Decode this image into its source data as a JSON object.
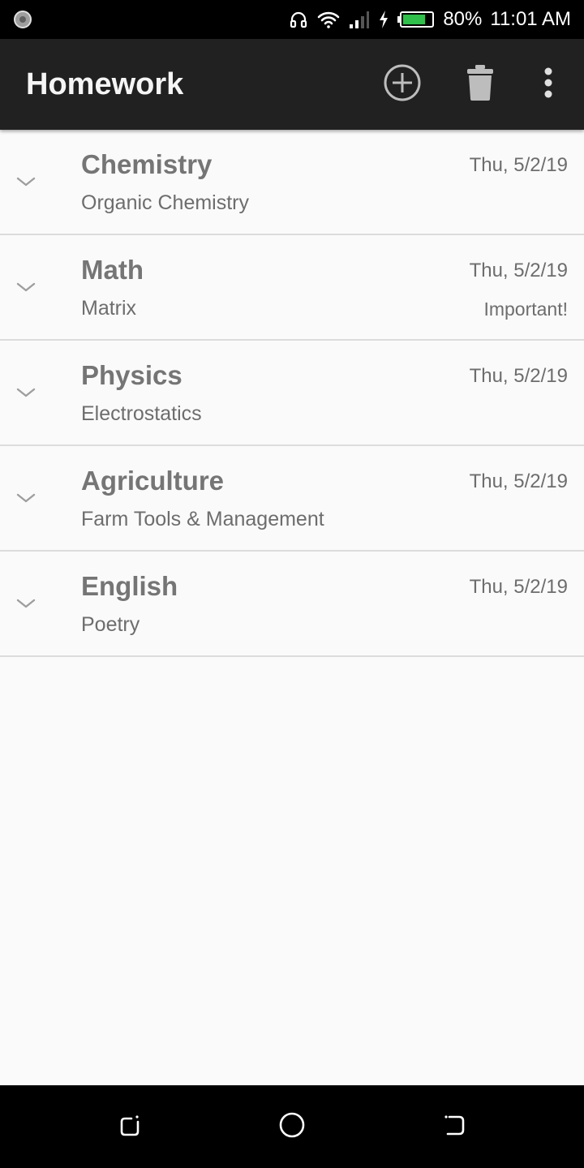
{
  "status_bar": {
    "battery_percent": "80%",
    "time": "11:01 AM",
    "battery_level": 0.8,
    "icons": [
      "app-notification-icon",
      "headset-icon",
      "wifi-icon",
      "signal-icon",
      "charging-icon",
      "battery-icon"
    ]
  },
  "app_bar": {
    "title": "Homework",
    "actions": [
      "add-circle-icon",
      "trash-icon",
      "more-vert-icon"
    ]
  },
  "homework_list": [
    {
      "subject": "Chemistry",
      "topic": "Organic Chemistry",
      "date": "Thu, 5/2/19",
      "flag": ""
    },
    {
      "subject": "Math",
      "topic": "Matrix",
      "date": "Thu, 5/2/19",
      "flag": "Important!"
    },
    {
      "subject": "Physics",
      "topic": "Electrostatics",
      "date": "Thu, 5/2/19",
      "flag": ""
    },
    {
      "subject": "Agriculture",
      "topic": "Farm Tools & Management",
      "date": "Thu, 5/2/19",
      "flag": ""
    },
    {
      "subject": "English",
      "topic": "Poetry",
      "date": "Thu, 5/2/19",
      "flag": ""
    }
  ],
  "nav_bar": {
    "buttons": [
      "recents-icon",
      "home-icon",
      "back-icon"
    ]
  },
  "colors": {
    "app_bar": "#212121",
    "background": "#fafafa",
    "battery_fill": "#2fbf4a"
  }
}
